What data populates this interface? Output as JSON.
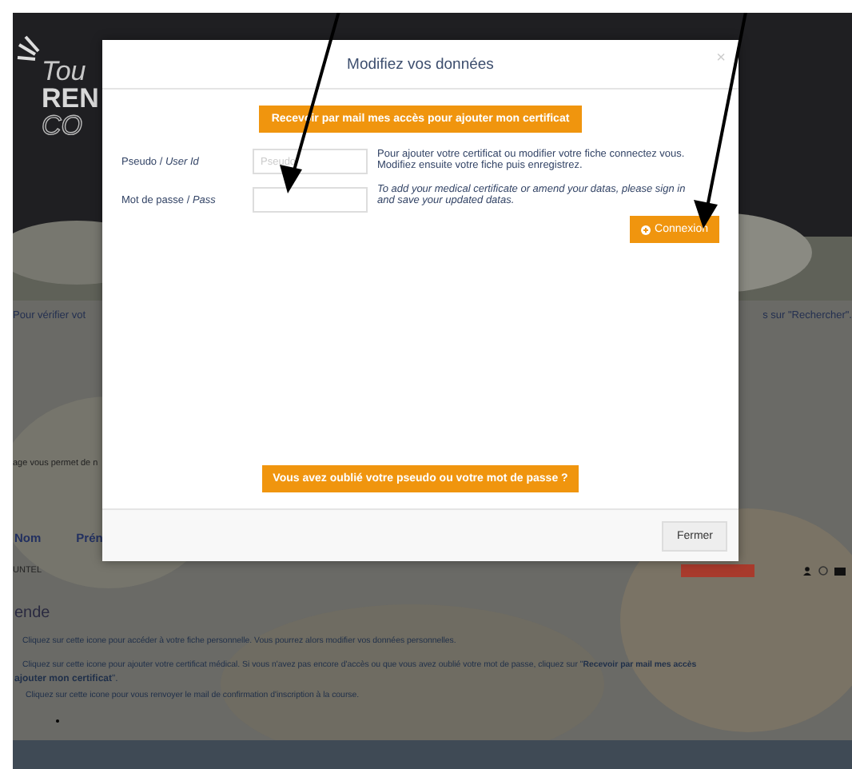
{
  "page": {
    "logo_lines": [
      "Tou",
      "REN",
      "CO"
    ],
    "intro_left": "Pour vérifier vot",
    "intro_right": "s sur \"Rechercher\".",
    "note": "age vous permet de n",
    "table": {
      "columns": [
        "Nom",
        "Prén"
      ],
      "row": [
        "UNTEL"
      ]
    },
    "legend": {
      "title": "ende",
      "lines": [
        "Cliquez sur cette icone pour accéder à votre fiche personnelle. Vous pourrez alors modifier vos données personnelles.",
        "Cliquez sur cette icone pour ajouter votre certificat médical. Si vous n'avez pas encore d'accès ou que vous avez oublié votre mot de passe, cliquez sur \"**Recevoir par mail mes accès**",
        "**ajouter mon certificat**\".",
        "Cliquez sur cette icone pour vous renvoyer le mail de confirmation d'inscription à la course."
      ]
    }
  },
  "modal": {
    "title": "Modifiez vos données",
    "close": "×",
    "mail_button": "Recevoir par mail mes accès pour ajouter mon certificat",
    "fields": [
      {
        "label": "Pseudo / *User Id*",
        "placeholder": "Pseudo"
      },
      {
        "label": "Mot de passe / *Pass*"
      }
    ],
    "help_fr": "Pour ajouter votre certificat ou modifier votre fiche connectez vous. Modifiez ensuite votre fiche puis enregistrez.",
    "help_en": "To add your medical certificate or amend your datas, please sign in and save your updated datas.",
    "login_button": "Connexion",
    "forgot_button": "Vous avez oublié votre pseudo ou votre mot de passe ?",
    "close_button": "Fermer"
  }
}
